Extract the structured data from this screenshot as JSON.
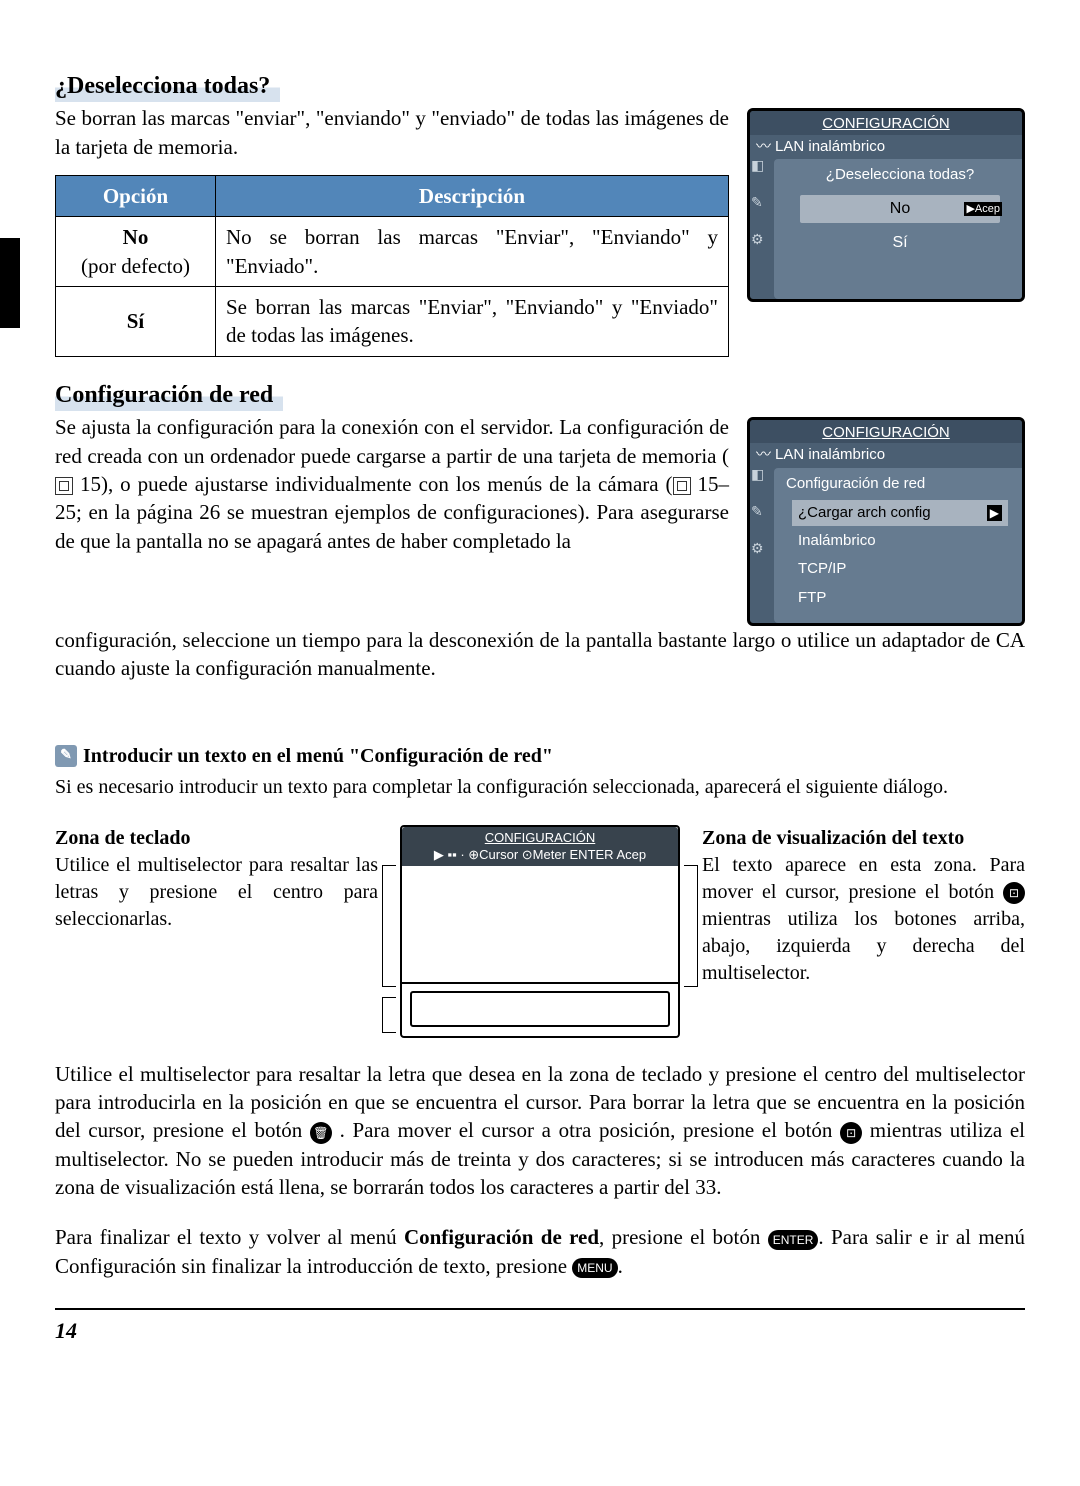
{
  "sec1": {
    "title": "¿Deselecciona todas?",
    "para": "Se borran las marcas \"enviar\", \"enviando\" y \"enviado\" de todas las imágenes de la tarjeta de memoria.",
    "table": {
      "h1": "Opción",
      "h2": "Descripción",
      "r1_opt": "No",
      "r1_sub": "(por defecto)",
      "r1_desc": "No se borran las marcas \"Enviar\", \"Enviando\" y \"Enviado\".",
      "r2_opt": "Sí",
      "r2_desc": "Se borran las marcas \"Enviar\", \"Enviando\" y \"Enviado\" de todas las imágenes."
    },
    "screen": {
      "header": "CONFIGURACIÓN",
      "sub": "LAN inalámbrico",
      "title_q": "¿Deselecciona todas?",
      "opt_no": "No",
      "opt_no_btn": "▶Acep",
      "opt_si": "Sí"
    }
  },
  "sec2": {
    "title": "Configuración de red",
    "para": "Se ajusta la configuración para la conexión con el servidor. La configuración de red creada con un ordenador puede cargarse a partir de una tarjeta de memoria ( 15), o puede ajustarse individualmente con los menús de la cámara ( 15–25; en la página 26 se muestran ejemplos de configuraciones). Para asegurarse de que la pantalla no se apagará antes de haber completado la configuración, seleccione un tiempo para la desconexión de la pantalla bastante largo o utilice un adaptador de CA cuando ajuste la configuración manualmente.",
    "screen": {
      "header": "CONFIGURACIÓN",
      "sub": "LAN inalámbrico",
      "panel_title": "Configuración de red",
      "i1": "¿Cargar arch config",
      "i1_btn": "▶",
      "i2": "Inalámbrico",
      "i3": "TCP/IP",
      "i4": "FTP"
    }
  },
  "note": {
    "title": "Introducir un texto en el menú \"Configuración de red\"",
    "body": "Si es necesario introducir un texto para completar la configuración seleccionada, aparecerá el siguiente diálogo.",
    "left_h": "Zona de teclado",
    "left_b": "Utilice el multiselector para resaltar las letras y presione el centro para seleccionarlas.",
    "right_h": "Zona de visualización del texto",
    "right_b1": "El texto aparece en esta zona. Para mover el cursor, presione el botón ",
    "right_b2": " mientras utiliza los botones arriba, abajo, izquierda y derecha del multiselector.",
    "kb_header1": "CONFIGURACIÓN",
    "kb_header2": "▶ ▪▪ · ⊕Cursor ⊙Meter ENTER Acep"
  },
  "p2a": "Utilice el multiselector para resaltar la letra que desea en la zona de teclado y presione el centro del multiselector para introducirla en la posición en que se encuentra el cursor. Para borrar la letra que se encuentra en la posición del cursor, presione el botón ",
  "p2b": ". Para mover el cursor a otra posición, presione el botón ",
  "p2c": " mientras utiliza el multiselector. No se pueden introducir más de treinta y dos caracteres; si se introducen más caracteres cuando la zona de visualización está llena, se borrarán todos los caracteres a partir del 33.",
  "p3a": "Para finalizar el texto y volver al menú ",
  "p3bold": "Configuración de red",
  "p3b": ", presione el botón ",
  "p3c": ". Para salir e ir al menú Configuración sin finalizar la introducción de texto, presione ",
  "p3d": ".",
  "enter_lbl": "ENTER",
  "menu_lbl": "MENU",
  "trash_lbl": "🗑",
  "thumb_lbl": "⊡",
  "page": "14"
}
